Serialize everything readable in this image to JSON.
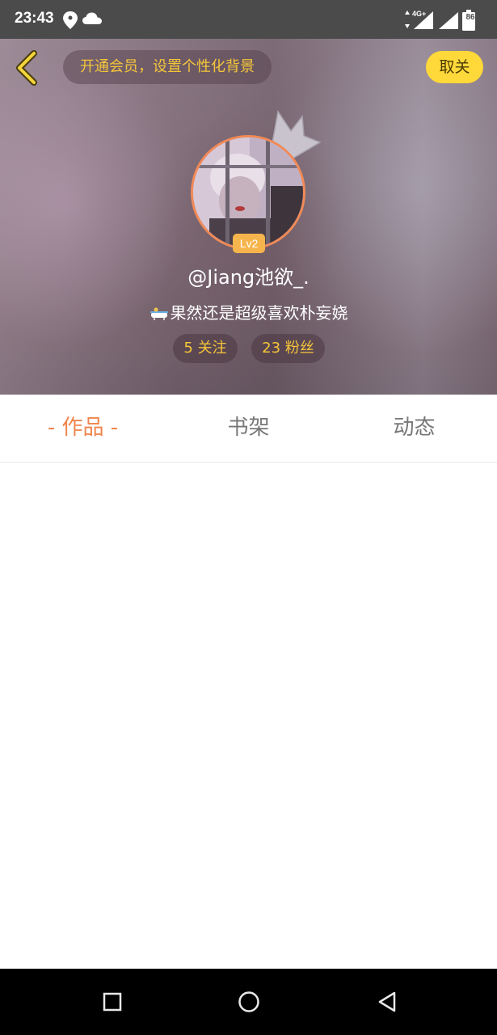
{
  "status_bar": {
    "time": "23:43",
    "network": "4G+",
    "battery": "86",
    "icons": [
      "location-icon",
      "cloud-icon",
      "signal-4g-icon",
      "signal-icon",
      "battery-icon"
    ]
  },
  "header": {
    "member_prompt": "开通会员，设置个性化背景",
    "follow_button": "取关",
    "level": "Lv2",
    "username": "@Jiang池欲_.",
    "bio": "果然还是超级喜欢朴妄娆",
    "following": "5 关注",
    "fans": "23 粉丝"
  },
  "tabs": [
    {
      "label": "- 作品 -",
      "active": true
    },
    {
      "label": "书架",
      "active": false
    },
    {
      "label": "动态",
      "active": false
    }
  ],
  "colors": {
    "accent": "#f0844c",
    "gold": "#f5c53a",
    "follow_button": "#ffd83a",
    "status_bar": "#4b4b4b"
  },
  "nav_bar": {
    "icons": [
      "recents-icon",
      "home-icon",
      "back-icon"
    ]
  }
}
